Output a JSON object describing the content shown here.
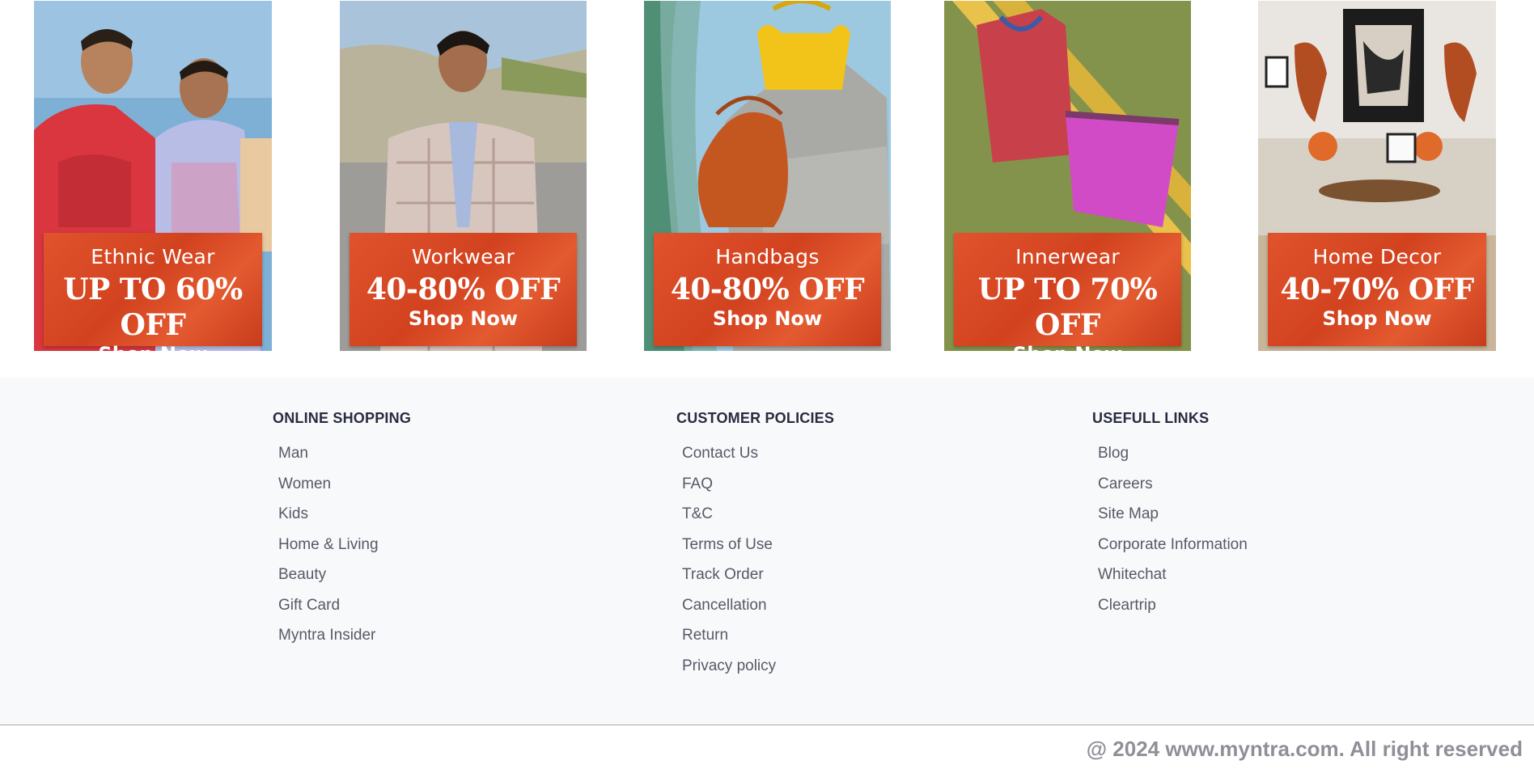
{
  "promos": [
    {
      "category": "Ethnic Wear",
      "offer": "UP TO 60% OFF",
      "cta": "Shop Now",
      "image": "ethnic-wear-photo"
    },
    {
      "category": "Workwear",
      "offer": "40-80% OFF",
      "cta": "Shop Now",
      "image": "workwear-photo"
    },
    {
      "category": "Handbags",
      "offer": "40-80% OFF",
      "cta": "Shop Now",
      "image": "handbags-photo"
    },
    {
      "category": "Innerwear",
      "offer": "UP TO 70% OFF",
      "cta": "Shop Now",
      "image": "innerwear-photo"
    },
    {
      "category": "Home Decor",
      "offer": "40-70% OFF",
      "cta": "Shop Now",
      "image": "home-decor-photo"
    }
  ],
  "footer": {
    "online_shopping": {
      "heading": "ONLINE SHOPPING",
      "links": [
        "Man",
        "Women",
        "Kids",
        "Home & Living",
        "Beauty",
        "Gift Card",
        "Myntra Insider"
      ]
    },
    "customer_policies": {
      "heading": "CUSTOMER POLICIES",
      "links": [
        "Contact Us",
        "FAQ",
        "T&C",
        "Terms of Use",
        "Track Order",
        "Cancellation",
        "Return",
        "Privacy policy"
      ]
    },
    "useful_links": {
      "heading": "USEFULL LINKS",
      "links": [
        "Blog",
        "Careers",
        "Site Map",
        "Corporate Information",
        "Whitechat",
        "Cleartrip"
      ]
    },
    "copyright": "@ 2024 www.myntra.com. All right reserved"
  },
  "colors": {
    "banner": "#d9482a",
    "footer_bg": "#f8f9fb",
    "heading": "#282c3f",
    "link": "#555a66",
    "copyright": "#8f9097"
  }
}
